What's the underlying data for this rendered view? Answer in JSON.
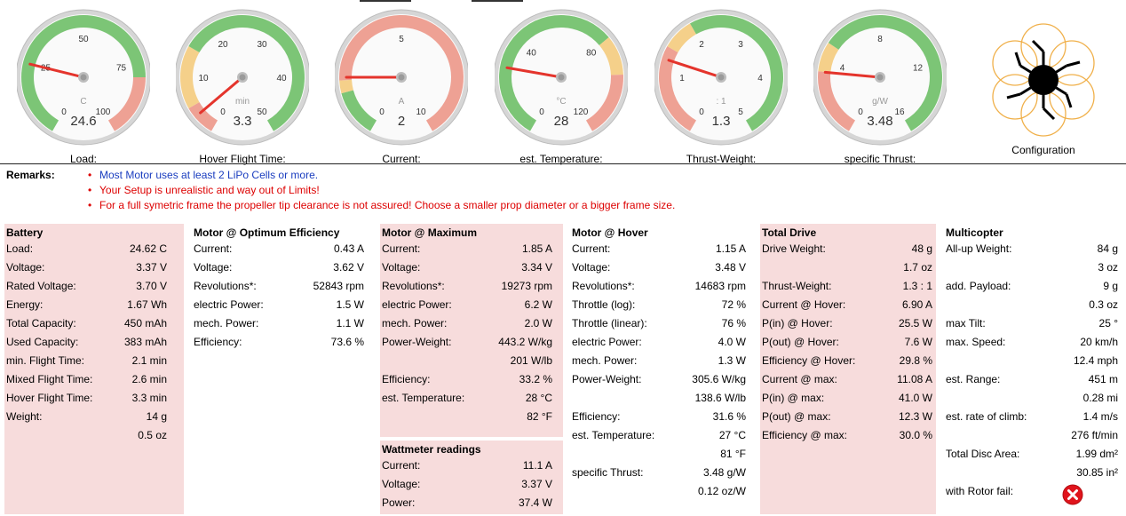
{
  "gauges": [
    {
      "key": "load",
      "caption": "Load:",
      "unit": "C",
      "value": "24.6",
      "ticks": [
        "0",
        "25",
        "50",
        "75",
        "100"
      ],
      "min": 0,
      "max": 100,
      "reading": 24.6,
      "zones": [
        {
          "from": 0,
          "to": 80,
          "color": "#7cc576"
        },
        {
          "from": 80,
          "to": 100,
          "color": "#eea194"
        }
      ]
    },
    {
      "key": "flight",
      "caption": "Hover Flight Time:",
      "unit": "min",
      "value": "3.3",
      "ticks": [
        "0",
        "10",
        "20",
        "30",
        "40",
        "50"
      ],
      "min": 0,
      "max": 50,
      "reading": 3.3,
      "zones": [
        {
          "from": 0,
          "to": 5,
          "color": "#eea194"
        },
        {
          "from": 5,
          "to": 15,
          "color": "#f5d08a"
        },
        {
          "from": 15,
          "to": 50,
          "color": "#7cc576"
        }
      ]
    },
    {
      "key": "current",
      "caption": "Current:",
      "unit": "A",
      "value": "2",
      "ticks": [
        "0",
        "5",
        "10"
      ],
      "min": 0,
      "max": 10,
      "reading": 2,
      "zones": [
        {
          "from": 0,
          "to": 1.5,
          "color": "#7cc576"
        },
        {
          "from": 1.5,
          "to": 1.9,
          "color": "#f5d08a"
        },
        {
          "from": 1.9,
          "to": 10,
          "color": "#eea194"
        }
      ]
    },
    {
      "key": "temp",
      "caption": "est. Temperature:",
      "unit": "°C",
      "value": "28",
      "ticks": [
        "0",
        "40",
        "80",
        "120"
      ],
      "min": 0,
      "max": 120,
      "reading": 28,
      "zones": [
        {
          "from": 0,
          "to": 80,
          "color": "#7cc576"
        },
        {
          "from": 80,
          "to": 95,
          "color": "#f5d08a"
        },
        {
          "from": 95,
          "to": 120,
          "color": "#eea194"
        }
      ]
    },
    {
      "key": "thrust",
      "caption": "Thrust-Weight:",
      "unit": ": 1",
      "value": "1.3",
      "ticks": [
        "0",
        "1",
        "2",
        "3",
        "4",
        "5"
      ],
      "min": 0,
      "max": 5,
      "reading": 1.3,
      "zones": [
        {
          "from": 0,
          "to": 1.5,
          "color": "#eea194"
        },
        {
          "from": 1.5,
          "to": 2,
          "color": "#f5d08a"
        },
        {
          "from": 2,
          "to": 5,
          "color": "#7cc576"
        }
      ]
    },
    {
      "key": "specific",
      "caption": "specific Thrust:",
      "unit": "g/W",
      "value": "3.48",
      "ticks": [
        "0",
        "4",
        "8",
        "12",
        "16"
      ],
      "min": 0,
      "max": 16,
      "reading": 3.48,
      "zones": [
        {
          "from": 0,
          "to": 3.5,
          "color": "#eea194"
        },
        {
          "from": 3.5,
          "to": 5,
          "color": "#f5d08a"
        },
        {
          "from": 5,
          "to": 16,
          "color": "#7cc576"
        }
      ]
    }
  ],
  "configuration": {
    "caption": "Configuration"
  },
  "remarks": {
    "label": "Remarks:",
    "items": [
      {
        "text": "Most Motor uses at least 2 LiPo Cells or more.",
        "color": "blue"
      },
      {
        "text": "Your Setup is unrealistic and way out of Limits!",
        "color": "red"
      },
      {
        "text": "For a full symetric frame the propeller tip clearance is not assured! Choose a smaller prop diameter or a bigger frame size.",
        "color": "red"
      }
    ]
  },
  "sections": {
    "battery": {
      "title": "Battery",
      "rows": [
        [
          "Load:",
          "24.62 C"
        ],
        [
          "Voltage:",
          "3.37 V"
        ],
        [
          "Rated Voltage:",
          "3.70 V"
        ],
        [
          "Energy:",
          "1.67 Wh"
        ],
        [
          "Total Capacity:",
          "450 mAh"
        ],
        [
          "Used Capacity:",
          "383 mAh"
        ],
        [
          "min. Flight Time:",
          "2.1 min"
        ],
        [
          "Mixed Flight Time:",
          "2.6 min"
        ],
        [
          "Hover Flight Time:",
          "3.3 min"
        ],
        [
          "Weight:",
          "14 g"
        ],
        [
          "",
          "0.5 oz"
        ]
      ]
    },
    "optimum": {
      "title": "Motor @ Optimum Efficiency",
      "rows": [
        [
          "Current:",
          "0.43 A"
        ],
        [
          "Voltage:",
          "3.62 V"
        ],
        [
          "Revolutions*:",
          "52843 rpm"
        ],
        [
          "electric Power:",
          "1.5 W"
        ],
        [
          "mech. Power:",
          "1.1 W"
        ],
        [
          "Efficiency:",
          "73.6 %"
        ]
      ]
    },
    "maximum": {
      "title": "Motor @ Maximum",
      "rows": [
        [
          "Current:",
          "1.85 A"
        ],
        [
          "Voltage:",
          "3.34 V"
        ],
        [
          "Revolutions*:",
          "19273 rpm"
        ],
        [
          "electric Power:",
          "6.2 W"
        ],
        [
          "mech. Power:",
          "2.0 W"
        ],
        [
          "Power-Weight:",
          "443.2 W/kg"
        ],
        [
          "",
          "201 W/lb"
        ],
        [
          "Efficiency:",
          "33.2 %"
        ],
        [
          "est. Temperature:",
          "28 °C"
        ],
        [
          "",
          "82 °F"
        ]
      ]
    },
    "wattmeter": {
      "title": "Wattmeter readings",
      "rows": [
        [
          "Current:",
          "11.1 A"
        ],
        [
          "Voltage:",
          "3.37 V"
        ],
        [
          "Power:",
          "37.4 W"
        ]
      ]
    },
    "hover": {
      "title": "Motor @ Hover",
      "rows": [
        [
          "Current:",
          "1.15 A"
        ],
        [
          "Voltage:",
          "3.48 V"
        ],
        [
          "Revolutions*:",
          "14683 rpm"
        ],
        [
          "Throttle (log):",
          "72 %"
        ],
        [
          "Throttle (linear):",
          "76 %"
        ],
        [
          "electric Power:",
          "4.0 W"
        ],
        [
          "mech. Power:",
          "1.3 W"
        ],
        [
          "Power-Weight:",
          "305.6 W/kg"
        ],
        [
          "",
          "138.6 W/lb"
        ],
        [
          "Efficiency:",
          "31.6 %"
        ],
        [
          "est. Temperature:",
          "27 °C"
        ],
        [
          "",
          "81 °F"
        ],
        [
          "specific Thrust:",
          "3.48 g/W"
        ],
        [
          "",
          "0.12 oz/W"
        ]
      ]
    },
    "drive": {
      "title": "Total Drive",
      "rows": [
        [
          "Drive Weight:",
          "48 g"
        ],
        [
          "",
          "1.7 oz"
        ],
        [
          "Thrust-Weight:",
          "1.3 : 1"
        ],
        [
          "Current @ Hover:",
          "6.90 A"
        ],
        [
          "P(in) @ Hover:",
          "25.5 W"
        ],
        [
          "P(out) @ Hover:",
          "7.6 W"
        ],
        [
          "Efficiency @ Hover:",
          "29.8 %"
        ],
        [
          "Current @ max:",
          "11.08 A"
        ],
        [
          "P(in) @ max:",
          "41.0 W"
        ],
        [
          "P(out) @ max:",
          "12.3 W"
        ],
        [
          "Efficiency @ max:",
          "30.0 %"
        ]
      ]
    },
    "multicopter": {
      "title": "Multicopter",
      "rows": [
        [
          "All-up Weight:",
          "84 g"
        ],
        [
          "",
          "3 oz"
        ],
        [
          "add. Payload:",
          "9 g"
        ],
        [
          "",
          "0.3 oz"
        ],
        [
          "max Tilt:",
          "25 °"
        ],
        [
          "max. Speed:",
          "20 km/h"
        ],
        [
          "",
          "12.4 mph"
        ],
        [
          "est. Range:",
          "451 m"
        ],
        [
          "",
          "0.28 mi"
        ],
        [
          "est. rate of climb:",
          "1.4 m/s"
        ],
        [
          "",
          "276 ft/min"
        ],
        [
          "Total Disc Area:",
          "1.99 dm²"
        ],
        [
          "",
          "30.85 in²"
        ],
        [
          "with Rotor fail:",
          ""
        ]
      ]
    }
  }
}
